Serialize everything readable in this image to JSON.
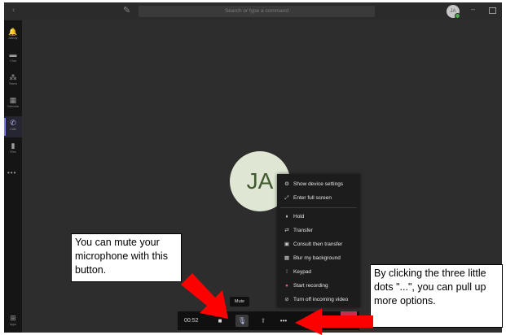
{
  "titlebar": {
    "back_icon": "back-arrow-icon",
    "compose_icon": "compose-icon",
    "search_placeholder": "Search or type a command",
    "avatar_initials": "JA",
    "minimize_glyph": "–"
  },
  "rail": {
    "items": [
      {
        "label": "Activity",
        "icon": "bell-icon",
        "glyph": "🔔"
      },
      {
        "label": "Chat",
        "icon": "chat-icon",
        "glyph": "▬"
      },
      {
        "label": "Teams",
        "icon": "teams-icon",
        "glyph": "⁂"
      },
      {
        "label": "Calendar",
        "icon": "calendar-icon",
        "glyph": "▦"
      },
      {
        "label": "Calls",
        "icon": "phone-icon",
        "glyph": "✆"
      },
      {
        "label": "Files",
        "icon": "files-icon",
        "glyph": "▮"
      }
    ],
    "more": "•••",
    "apps_label": "Apps",
    "apps_glyph": "⊞"
  },
  "stage": {
    "avatar_text": "JA"
  },
  "menu": {
    "items": [
      {
        "label": "Show device settings",
        "icon": "gear-icon",
        "glyph": "⚙"
      },
      {
        "label": "Enter full screen",
        "icon": "fullscreen-icon",
        "glyph": "⤢"
      },
      {
        "label": "Hold",
        "icon": "pause-icon",
        "glyph": "⏸"
      },
      {
        "label": "Transfer",
        "icon": "transfer-icon",
        "glyph": "⇄"
      },
      {
        "label": "Consult then transfer",
        "icon": "consult-icon",
        "glyph": "▣"
      },
      {
        "label": "Blur my background",
        "icon": "blur-icon",
        "glyph": "▩"
      },
      {
        "label": "Keypad",
        "icon": "keypad-icon",
        "glyph": "⁞"
      },
      {
        "label": "Start recording",
        "icon": "record-icon",
        "glyph": "●"
      },
      {
        "label": "Turn off incoming video",
        "icon": "video-off-icon",
        "glyph": "⊘"
      }
    ]
  },
  "controls": {
    "timer": "00:52",
    "camera_glyph": "■",
    "mic_glyph": "🎙",
    "share_glyph": "⬆",
    "more_glyph": "•••",
    "mute_tooltip": "Mute"
  },
  "annotations": {
    "mute_note": "You can mute your microphone with this button.",
    "dots_note": "By clicking the three little dots \"...\", you can pull up more options.",
    "arrow_color": "#ff0000"
  }
}
